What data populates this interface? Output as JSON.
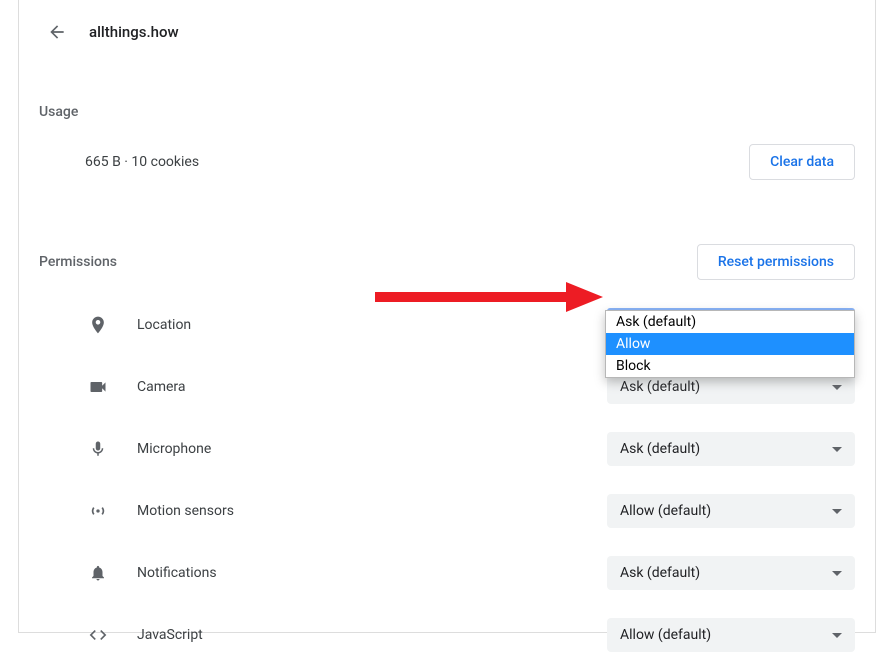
{
  "header": {
    "site_title": "allthings.how"
  },
  "usage": {
    "heading": "Usage",
    "text": "665 B · 10 cookies",
    "clear_button": "Clear data"
  },
  "permissions": {
    "heading": "Permissions",
    "reset_button": "Reset permissions",
    "items": [
      {
        "label": "Location",
        "value": "Ask (default)",
        "icon": "location-icon",
        "focused": true
      },
      {
        "label": "Camera",
        "value": "Ask (default)",
        "icon": "camera-icon",
        "behind_popup": true
      },
      {
        "label": "Microphone",
        "value": "Ask (default)",
        "icon": "microphone-icon"
      },
      {
        "label": "Motion sensors",
        "value": "Allow (default)",
        "icon": "motion-icon"
      },
      {
        "label": "Notifications",
        "value": "Ask (default)",
        "icon": "bell-icon"
      },
      {
        "label": "JavaScript",
        "value": "Allow (default)",
        "icon": "code-icon"
      }
    ],
    "dropdown_options": [
      {
        "label": "Ask (default)",
        "selected": false
      },
      {
        "label": "Allow",
        "selected": true
      },
      {
        "label": "Block",
        "selected": false
      }
    ]
  },
  "colors": {
    "accent_blue": "#1a73e8",
    "text_primary": "#202124",
    "text_secondary": "#5f6368",
    "dropdown_bg": "#f1f3f4",
    "arrow_red": "#ed1c24"
  }
}
